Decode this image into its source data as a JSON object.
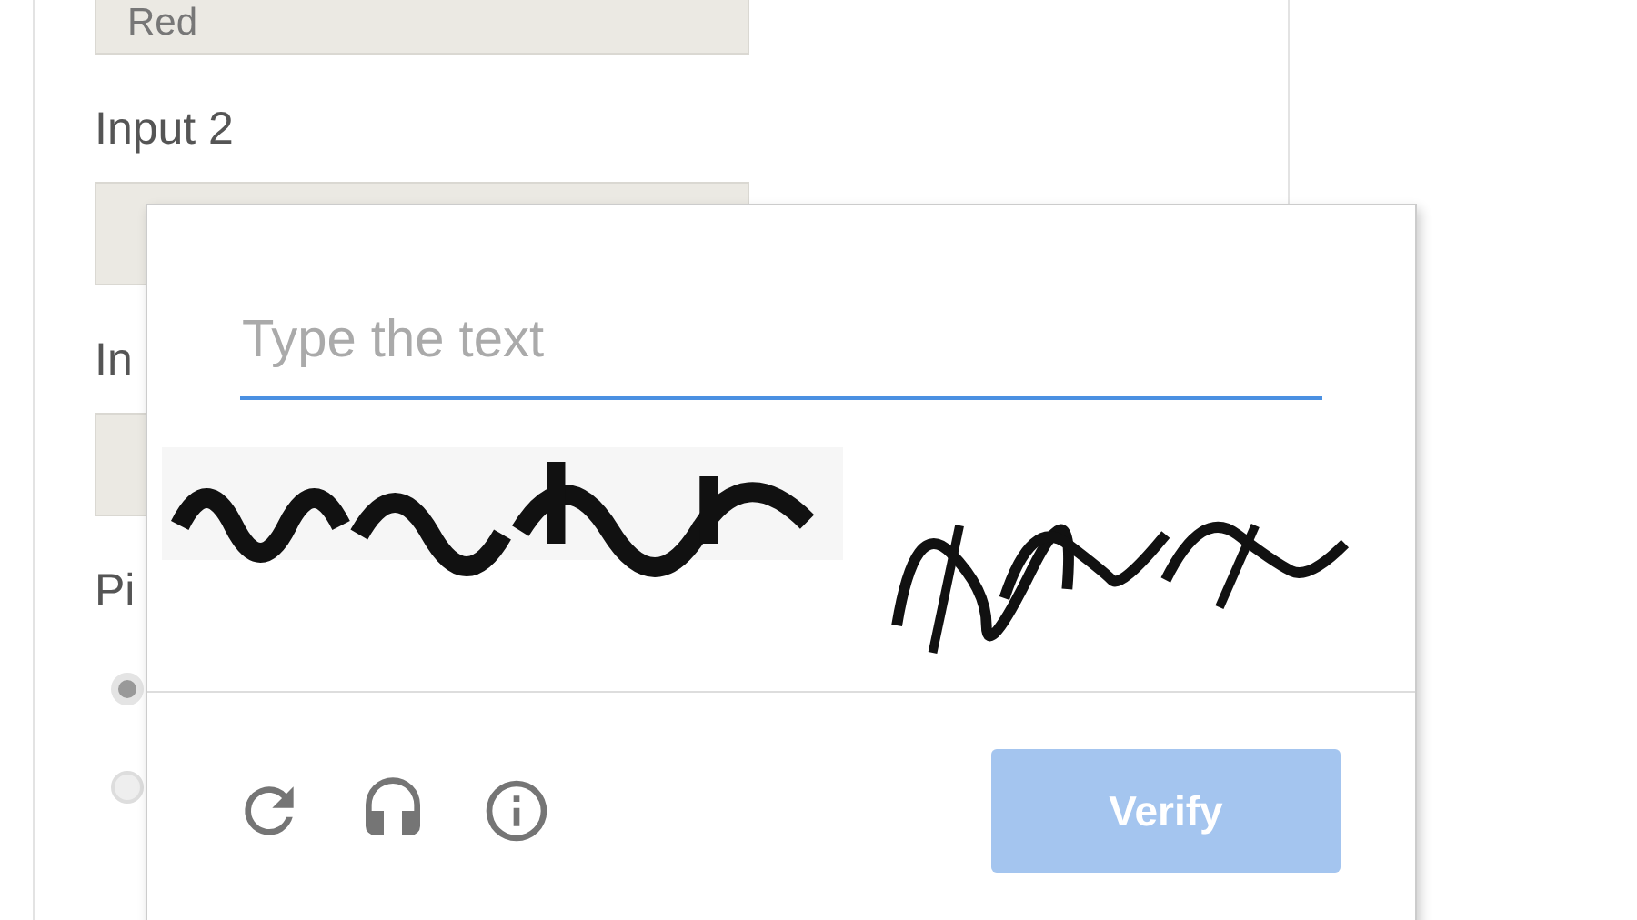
{
  "form": {
    "fields": [
      {
        "kind": "field",
        "value": "Red"
      },
      {
        "kind": "label",
        "text": "Input 2"
      },
      {
        "kind": "field"
      },
      {
        "kind": "label",
        "text": "In"
      },
      {
        "kind": "field"
      },
      {
        "kind": "label",
        "text": "Pi"
      },
      {
        "kind": "radio",
        "selected": true
      },
      {
        "kind": "radio",
        "selected": false
      }
    ]
  },
  "captcha": {
    "placeholder": "Type the text",
    "verify_button": {
      "label": "Verify",
      "disabled": true
    }
  }
}
